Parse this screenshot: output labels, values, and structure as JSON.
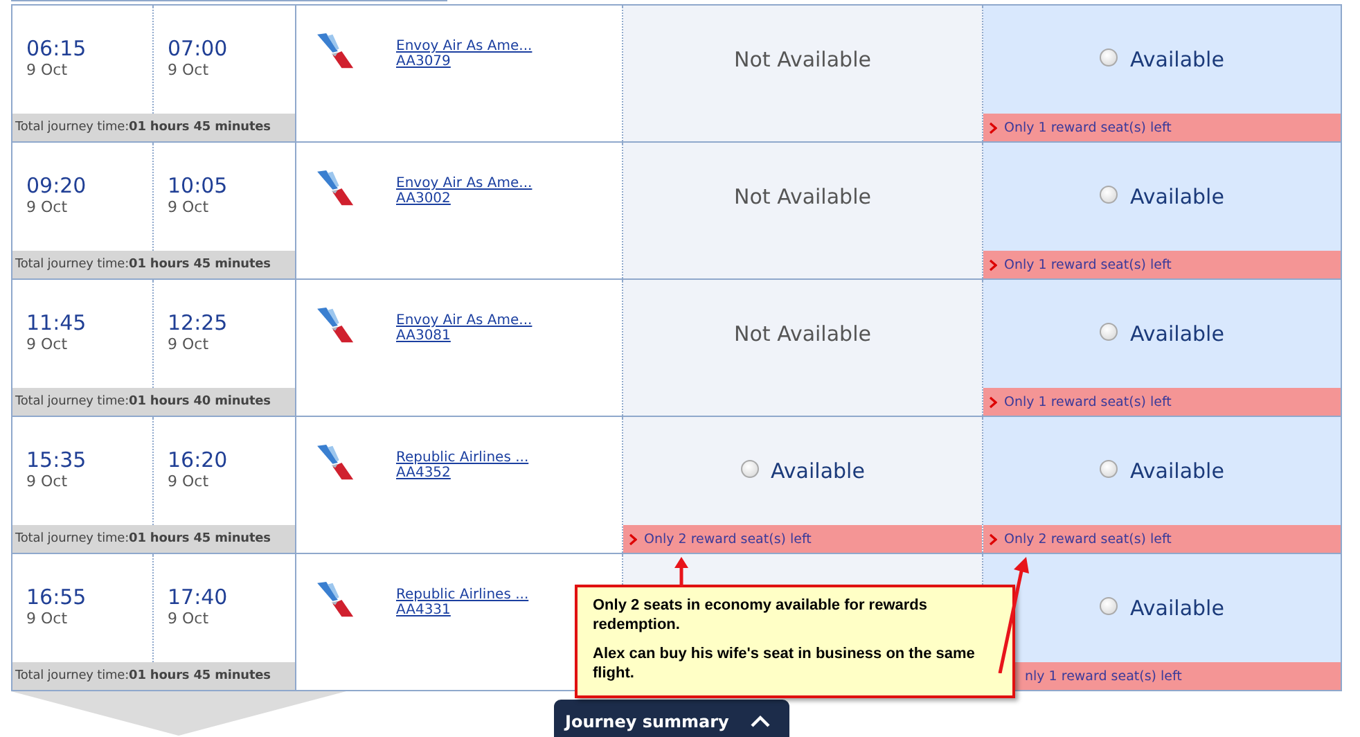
{
  "flights": [
    {
      "depart": {
        "time": "06:15",
        "date": "9 Oct"
      },
      "arrive": {
        "time": "07:00",
        "date": "9 Oct"
      },
      "journey_label": "Total journey time:",
      "journey_time": "01 hours 45 minutes",
      "airline": "Envoy Air As Ame...",
      "flight_number": "AA3079",
      "fares": [
        {
          "kind": "unavailable",
          "status": "Not Available"
        },
        {
          "kind": "available",
          "status": "Available",
          "selected": false,
          "notice": "Only 1 reward seat(s) left"
        }
      ]
    },
    {
      "depart": {
        "time": "09:20",
        "date": "9 Oct"
      },
      "arrive": {
        "time": "10:05",
        "date": "9 Oct"
      },
      "journey_label": "Total journey time:",
      "journey_time": "01 hours 45 minutes",
      "airline": "Envoy Air As Ame...",
      "flight_number": "AA3002",
      "fares": [
        {
          "kind": "unavailable",
          "status": "Not Available"
        },
        {
          "kind": "available",
          "status": "Available",
          "selected": false,
          "notice": "Only 1 reward seat(s) left"
        }
      ]
    },
    {
      "depart": {
        "time": "11:45",
        "date": "9 Oct"
      },
      "arrive": {
        "time": "12:25",
        "date": "9 Oct"
      },
      "journey_label": "Total journey time:",
      "journey_time": "01 hours 40 minutes",
      "airline": "Envoy Air As Ame...",
      "flight_number": "AA3081",
      "fares": [
        {
          "kind": "unavailable",
          "status": "Not Available"
        },
        {
          "kind": "available",
          "status": "Available",
          "selected": false,
          "notice": "Only 1 reward seat(s) left"
        }
      ]
    },
    {
      "depart": {
        "time": "15:35",
        "date": "9 Oct"
      },
      "arrive": {
        "time": "16:20",
        "date": "9 Oct"
      },
      "journey_label": "Total journey time:",
      "journey_time": "01 hours 45 minutes",
      "airline": "Republic Airlines ...",
      "flight_number": "AA4352",
      "fares": [
        {
          "kind": "available",
          "status": "Available",
          "selected": false,
          "notice": "Only 2 reward seat(s) left"
        },
        {
          "kind": "available",
          "status": "Available",
          "selected": false,
          "notice": "Only 2 reward seat(s) left"
        }
      ]
    },
    {
      "depart": {
        "time": "16:55",
        "date": "9 Oct"
      },
      "arrive": {
        "time": "17:40",
        "date": "9 Oct"
      },
      "journey_label": "Total journey time:",
      "journey_time": "01 hours 45 minutes",
      "airline": "Republic Airlines ...",
      "flight_number": "AA4331",
      "fares": [
        {
          "kind": "covered"
        },
        {
          "kind": "available",
          "status": "Available",
          "selected": false,
          "notice": "nly 1 reward seat(s) left",
          "notice_covered": true
        }
      ]
    }
  ],
  "callout": {
    "paragraphs": [
      "Only 2 seats in economy available for rewards redemption.",
      "Alex can buy his wife's seat in business on the same flight."
    ]
  },
  "summary_tab": {
    "label": "Journey summary",
    "expanded": false
  }
}
